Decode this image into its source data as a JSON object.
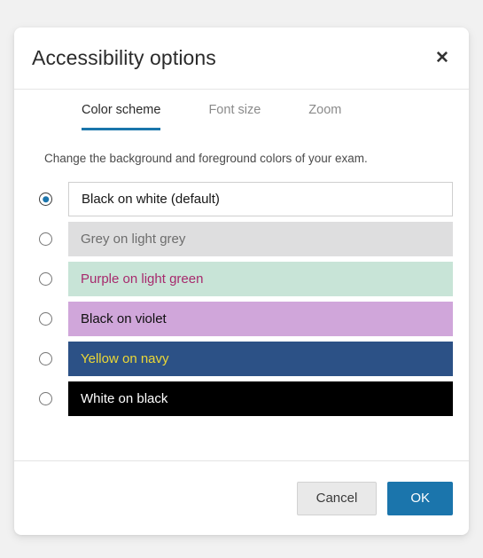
{
  "dialog": {
    "title": "Accessibility options",
    "close_label": "✕",
    "close_icon": "close-icon"
  },
  "tabs": [
    {
      "label": "Color scheme",
      "active": true
    },
    {
      "label": "Font size",
      "active": false
    },
    {
      "label": "Zoom",
      "active": false
    }
  ],
  "body": {
    "description": "Change the background and foreground colors of your exam."
  },
  "color_schemes": [
    {
      "label": "Black on white (default)",
      "selected": true,
      "bg": "#ffffff",
      "fg": "#161616",
      "bordered": true
    },
    {
      "label": "Grey on light grey",
      "selected": false,
      "bg": "#dededf",
      "fg": "#6d6d6d",
      "bordered": false
    },
    {
      "label": "Purple on light green",
      "selected": false,
      "bg": "#c8e4d7",
      "fg": "#a72a6d",
      "bordered": false
    },
    {
      "label": "Black on violet",
      "selected": false,
      "bg": "#d0a6da",
      "fg": "#101010",
      "bordered": false
    },
    {
      "label": "Yellow on navy",
      "selected": false,
      "bg": "#2c5186",
      "fg": "#ecd836",
      "bordered": false
    },
    {
      "label": "White on black",
      "selected": false,
      "bg": "#000000",
      "fg": "#ffffff",
      "bordered": false
    }
  ],
  "footer": {
    "cancel_label": "Cancel",
    "ok_label": "OK"
  },
  "colors": {
    "accent": "#1b75ac",
    "page_background": "#f1f1f1",
    "dialog_background": "#ffffff"
  }
}
